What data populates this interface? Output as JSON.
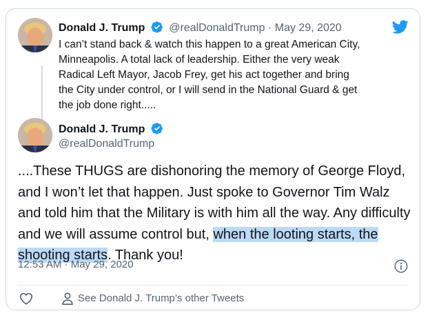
{
  "quoted_tweet": {
    "name": "Donald J. Trump",
    "handle": "@realDonaldTrump",
    "separator": "·",
    "date": "May 29, 2020",
    "text": "I can’t stand back & watch this happen to a great American City, Minneapolis. A total lack of leadership. Either the very weak Radical Left Mayor, Jacob Frey, get his act together and bring the City under control, or I will send in the National Guard & get the job done right....."
  },
  "main_tweet": {
    "name": "Donald J. Trump",
    "handle": "@realDonaldTrump",
    "text_before": "....These THUGS are dishonoring the memory of George Floyd, and I won’t let that happen. Just spoke to Governor Tim Walz and told him that the Military is with him all the way. Any difficulty and we will assume control but, ",
    "text_highlight": "when the looting starts, the shooting starts",
    "text_after": ". Thank you!",
    "timestamp": "12:53 AM · May 29, 2020"
  },
  "actions": {
    "see_other_tweets": "See Donald J. Trump’s other Tweets"
  },
  "colors": {
    "twitter_blue": "#1d9bf0",
    "secondary_text": "#536471",
    "highlight": "#bcd9f6",
    "border": "#cfd9de"
  },
  "icons": [
    "twitter-logo-icon",
    "verified-badge-icon",
    "info-icon",
    "heart-icon",
    "person-icon"
  ]
}
